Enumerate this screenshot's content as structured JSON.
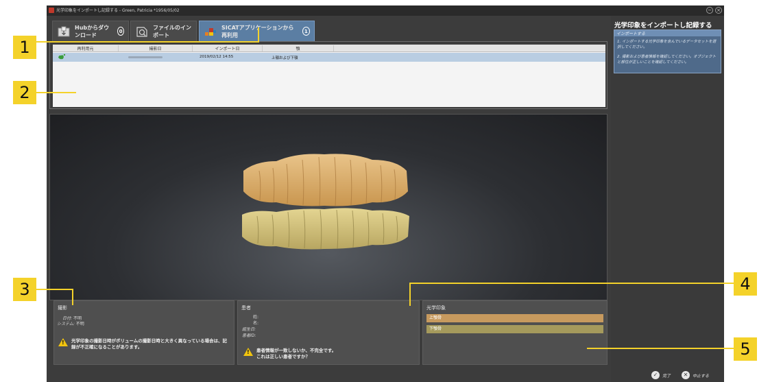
{
  "window": {
    "title": "光学印象をインポートし記録する - Green, Patricia *1956/05/02"
  },
  "tabs": [
    {
      "label": "Hubからダウンロード",
      "count": "0",
      "icon": "download-box-icon"
    },
    {
      "label": "ファイルのインポート",
      "icon": "file-import-icon"
    },
    {
      "label": "SICATアプリケーションから再利用",
      "count": "1",
      "icon": "sicat-logo-icon"
    }
  ],
  "table": {
    "columns": [
      "再利用元",
      "撮影日",
      "インポート日",
      "顎"
    ],
    "rows": [
      {
        "source_icon": "tooth-icon",
        "import_date": "2019/02/12 14:55",
        "jaw": "上顎および下顎"
      }
    ]
  },
  "capture": {
    "title": "撮影",
    "date_label": "日付:",
    "date_value": "不明",
    "system_label": "システム:",
    "system_value": "不明",
    "warning": "光学印象の撮影日時がボリュームの撮影日時と大きく異なっている場合は、記録が不正確になることがあります。"
  },
  "patient": {
    "title": "患者",
    "last_name_label": "姓:",
    "first_name_label": "名:",
    "birth_label": "誕生日:",
    "id_label": "患者ID:",
    "warning_line1": "患者情報が一致しないか、不完全です。",
    "warning_line2": "これは正しい患者ですか？"
  },
  "impression": {
    "title": "光学印象",
    "upper": "上顎骨",
    "lower": "下顎骨",
    "upper_color": "#c79a5e",
    "lower_color": "#a59a5c"
  },
  "sidebar": {
    "title": "光学印象をインポートし記録する",
    "section": "インポートする",
    "step1": "1. インポートする光学印象を含んでいるデータセットを選択してください。",
    "step2": "2. 撮影および患者情報を確認してください。オブジェクトと部位が正しいことを確認してください。"
  },
  "buttons": {
    "finish": "完了",
    "cancel": "中止する"
  },
  "callouts": [
    "1",
    "2",
    "3",
    "4",
    "5"
  ],
  "colors": {
    "callout": "#f4d22a",
    "active_tab": "#5b7ea3",
    "selected_row": "#b9cde2"
  }
}
